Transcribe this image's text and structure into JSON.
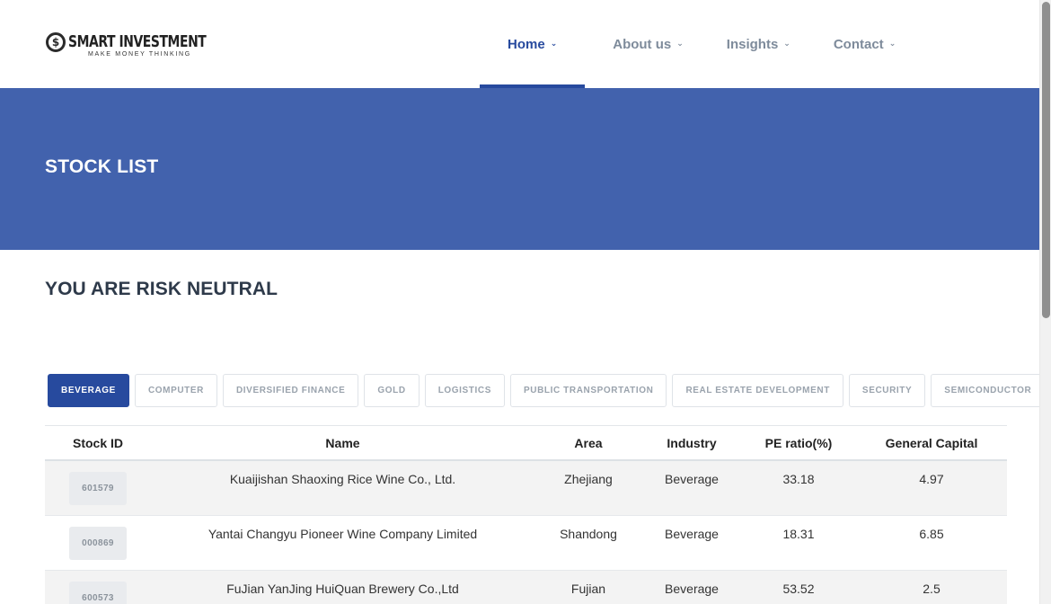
{
  "logo": {
    "icon": "dollar-coin-icon",
    "title": "SMART INVESTMENT",
    "tagline": "MAKE MONEY THINKING"
  },
  "nav": {
    "items": [
      {
        "label": "Home",
        "active": true
      },
      {
        "label": "About us",
        "active": false
      },
      {
        "label": "Insights",
        "active": false
      },
      {
        "label": "Contact",
        "active": false
      }
    ],
    "chevron": "⌄"
  },
  "banner": {
    "title": "STOCK LIST",
    "color": "#4262ad"
  },
  "risk": {
    "heading": "YOU ARE RISK NEUTRAL"
  },
  "tabs": [
    {
      "label": "BEVERAGE",
      "active": true
    },
    {
      "label": "COMPUTER"
    },
    {
      "label": "DIVERSIFIED FINANCE"
    },
    {
      "label": "GOLD"
    },
    {
      "label": "LOGISTICS"
    },
    {
      "label": "PUBLIC TRANSPORTATION"
    },
    {
      "label": "REAL ESTATE DEVELOPMENT"
    },
    {
      "label": "SECURITY"
    },
    {
      "label": "SEMICONDUCTOR"
    }
  ],
  "table": {
    "headers": [
      "Stock ID",
      "Name",
      "Area",
      "Industry",
      "PE ratio(%)",
      "General Capital"
    ],
    "rows": [
      {
        "id": "601579",
        "name": "Kuaijishan Shaoxing Rice Wine Co., Ltd.",
        "area": "Zhejiang",
        "industry": "Beverage",
        "pe": "33.18",
        "capital": "4.97"
      },
      {
        "id": "000869",
        "name": "Yantai Changyu Pioneer Wine Company Limited",
        "area": "Shandong",
        "industry": "Beverage",
        "pe": "18.31",
        "capital": "6.85"
      },
      {
        "id": "600573",
        "name": "FuJian YanJing HuiQuan Brewery Co.,Ltd",
        "area": "Fujian",
        "industry": "Beverage",
        "pe": "53.52",
        "capital": "2.5"
      }
    ]
  },
  "colors": {
    "accent": "#274a9e",
    "nav_inactive": "#7e8b9b"
  }
}
